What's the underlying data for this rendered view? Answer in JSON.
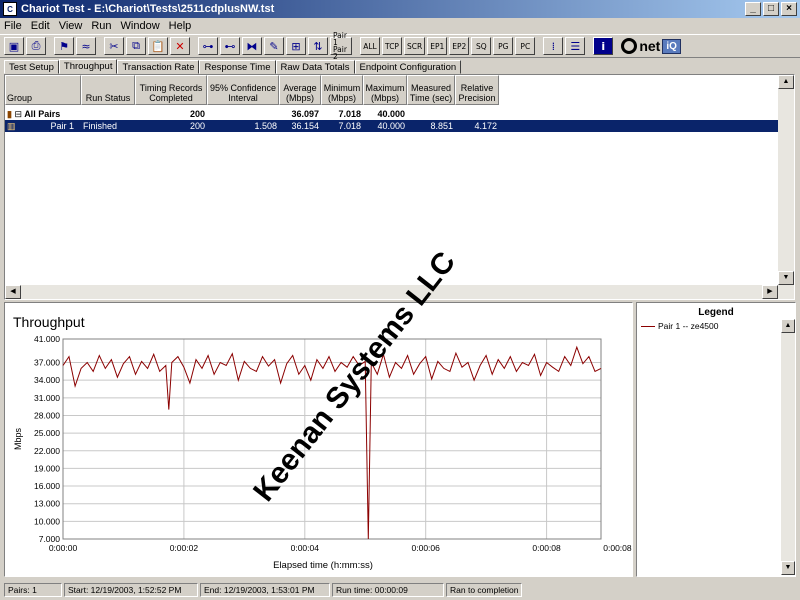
{
  "window": {
    "title": "Chariot Test - E:\\Chariot\\Tests\\2511cdplusNW.tst"
  },
  "menu": [
    "File",
    "Edit",
    "View",
    "Run",
    "Window",
    "Help"
  ],
  "toolbar": {
    "protocol_buttons": [
      "ALL",
      "TCP",
      "SCR",
      "EP1",
      "EP2",
      "SQ",
      "PG",
      "PC"
    ],
    "pair_label_1": "Pair 1",
    "pair_label_2": "Pair 2",
    "brand": "net",
    "brand_suffix": "iQ"
  },
  "tabs": [
    "Test Setup",
    "Throughput",
    "Transaction Rate",
    "Response Time",
    "Raw Data Totals",
    "Endpoint Configuration"
  ],
  "table": {
    "headers": [
      "Group",
      "Run Status",
      "Timing Records Completed",
      "95% Confidence Interval",
      "Average (Mbps)",
      "Minimum (Mbps)",
      "Maximum (Mbps)",
      "Measured Time (sec)",
      "Relative Precision"
    ],
    "rows": [
      {
        "group": "All Pairs",
        "status": "",
        "records": "200",
        "ci": "",
        "avg": "36.097",
        "min": "7.018",
        "max": "40.000",
        "time": "",
        "precision": ""
      },
      {
        "group": "Pair 1",
        "status": "Finished",
        "records": "200",
        "ci": "1.508",
        "avg": "36.154",
        "min": "7.018",
        "max": "40.000",
        "time": "8.851",
        "precision": "4.172"
      }
    ]
  },
  "chart_data": {
    "type": "line",
    "title": "Throughput",
    "xlabel": "Elapsed time (h:mm:ss)",
    "ylabel": "Mbps",
    "ylim": [
      7.0,
      41.0
    ],
    "yticks": [
      "41.000",
      "37.000",
      "34.000",
      "31.000",
      "28.000",
      "25.000",
      "22.000",
      "19.000",
      "16.000",
      "13.000",
      "10.000",
      "7.000"
    ],
    "xticks": [
      "0:00:00",
      "0:00:02",
      "0:00:04",
      "0:00:06",
      "0:00:08",
      "0:00:08.9"
    ],
    "xlim": [
      0,
      8.9
    ],
    "grid": true,
    "series": [
      {
        "name": "Pair 1 -- ze4500",
        "color": "#8b0000",
        "x": [
          0,
          0.1,
          0.2,
          0.3,
          0.4,
          0.5,
          0.6,
          0.7,
          0.8,
          0.9,
          1.0,
          1.1,
          1.2,
          1.3,
          1.4,
          1.5,
          1.6,
          1.7,
          1.75,
          1.8,
          1.9,
          2.0,
          2.1,
          2.2,
          2.3,
          2.4,
          2.5,
          2.6,
          2.7,
          2.8,
          2.9,
          3.0,
          3.1,
          3.2,
          3.3,
          3.4,
          3.5,
          3.6,
          3.7,
          3.8,
          3.9,
          4.0,
          4.1,
          4.2,
          4.3,
          4.4,
          4.5,
          4.6,
          4.7,
          4.8,
          4.9,
          5.0,
          5.05,
          5.1,
          5.2,
          5.3,
          5.4,
          5.5,
          5.6,
          5.7,
          5.8,
          5.9,
          6.0,
          6.1,
          6.2,
          6.3,
          6.4,
          6.5,
          6.6,
          6.7,
          6.8,
          6.9,
          7.0,
          7.1,
          7.2,
          7.3,
          7.4,
          7.5,
          7.6,
          7.7,
          7.8,
          7.9,
          8.0,
          8.1,
          8.2,
          8.3,
          8.4,
          8.5,
          8.6,
          8.7,
          8.8,
          8.9
        ],
        "y": [
          36.5,
          38.0,
          33.0,
          36.0,
          37.0,
          35.5,
          38.2,
          36.0,
          37.5,
          34.5,
          36.8,
          38.0,
          35.0,
          37.2,
          36.0,
          38.4,
          35.5,
          36.5,
          29.0,
          37.0,
          38.0,
          36.2,
          33.5,
          37.5,
          36.0,
          38.2,
          35.0,
          37.0,
          36.5,
          38.5,
          34.0,
          37.2,
          36.0,
          35.5,
          38.0,
          36.4,
          37.5,
          33.5,
          36.8,
          38.2,
          35.0,
          36.5,
          34.0,
          37.5,
          36.0,
          38.0,
          35.5,
          37.0,
          36.2,
          38.0,
          36.5,
          37.2,
          7.0,
          37.0,
          35.0,
          38.4,
          34.5,
          37.0,
          36.0,
          38.2,
          35.0,
          36.8,
          38.0,
          34.2,
          37.2,
          36.0,
          35.5,
          38.6,
          36.2,
          37.0,
          34.0,
          36.5,
          38.2,
          35.0,
          37.5,
          36.0,
          38.0,
          35.5,
          37.0,
          36.5,
          38.4,
          34.8,
          37.0,
          36.2,
          35.5,
          38.0,
          36.5,
          39.6,
          36.8,
          38.0,
          35.5,
          36.0
        ]
      }
    ]
  },
  "legend": {
    "title": "Legend",
    "entries": [
      "Pair 1 -- ze4500"
    ]
  },
  "status": {
    "pairs": "Pairs: 1",
    "start": "Start: 12/19/2003, 1:52:52 PM",
    "end": "End: 12/19/2003, 1:53:01 PM",
    "runtime": "Run time: 00:00:09",
    "result": "Ran to completion"
  },
  "watermark": "Keenan Systems LLC"
}
